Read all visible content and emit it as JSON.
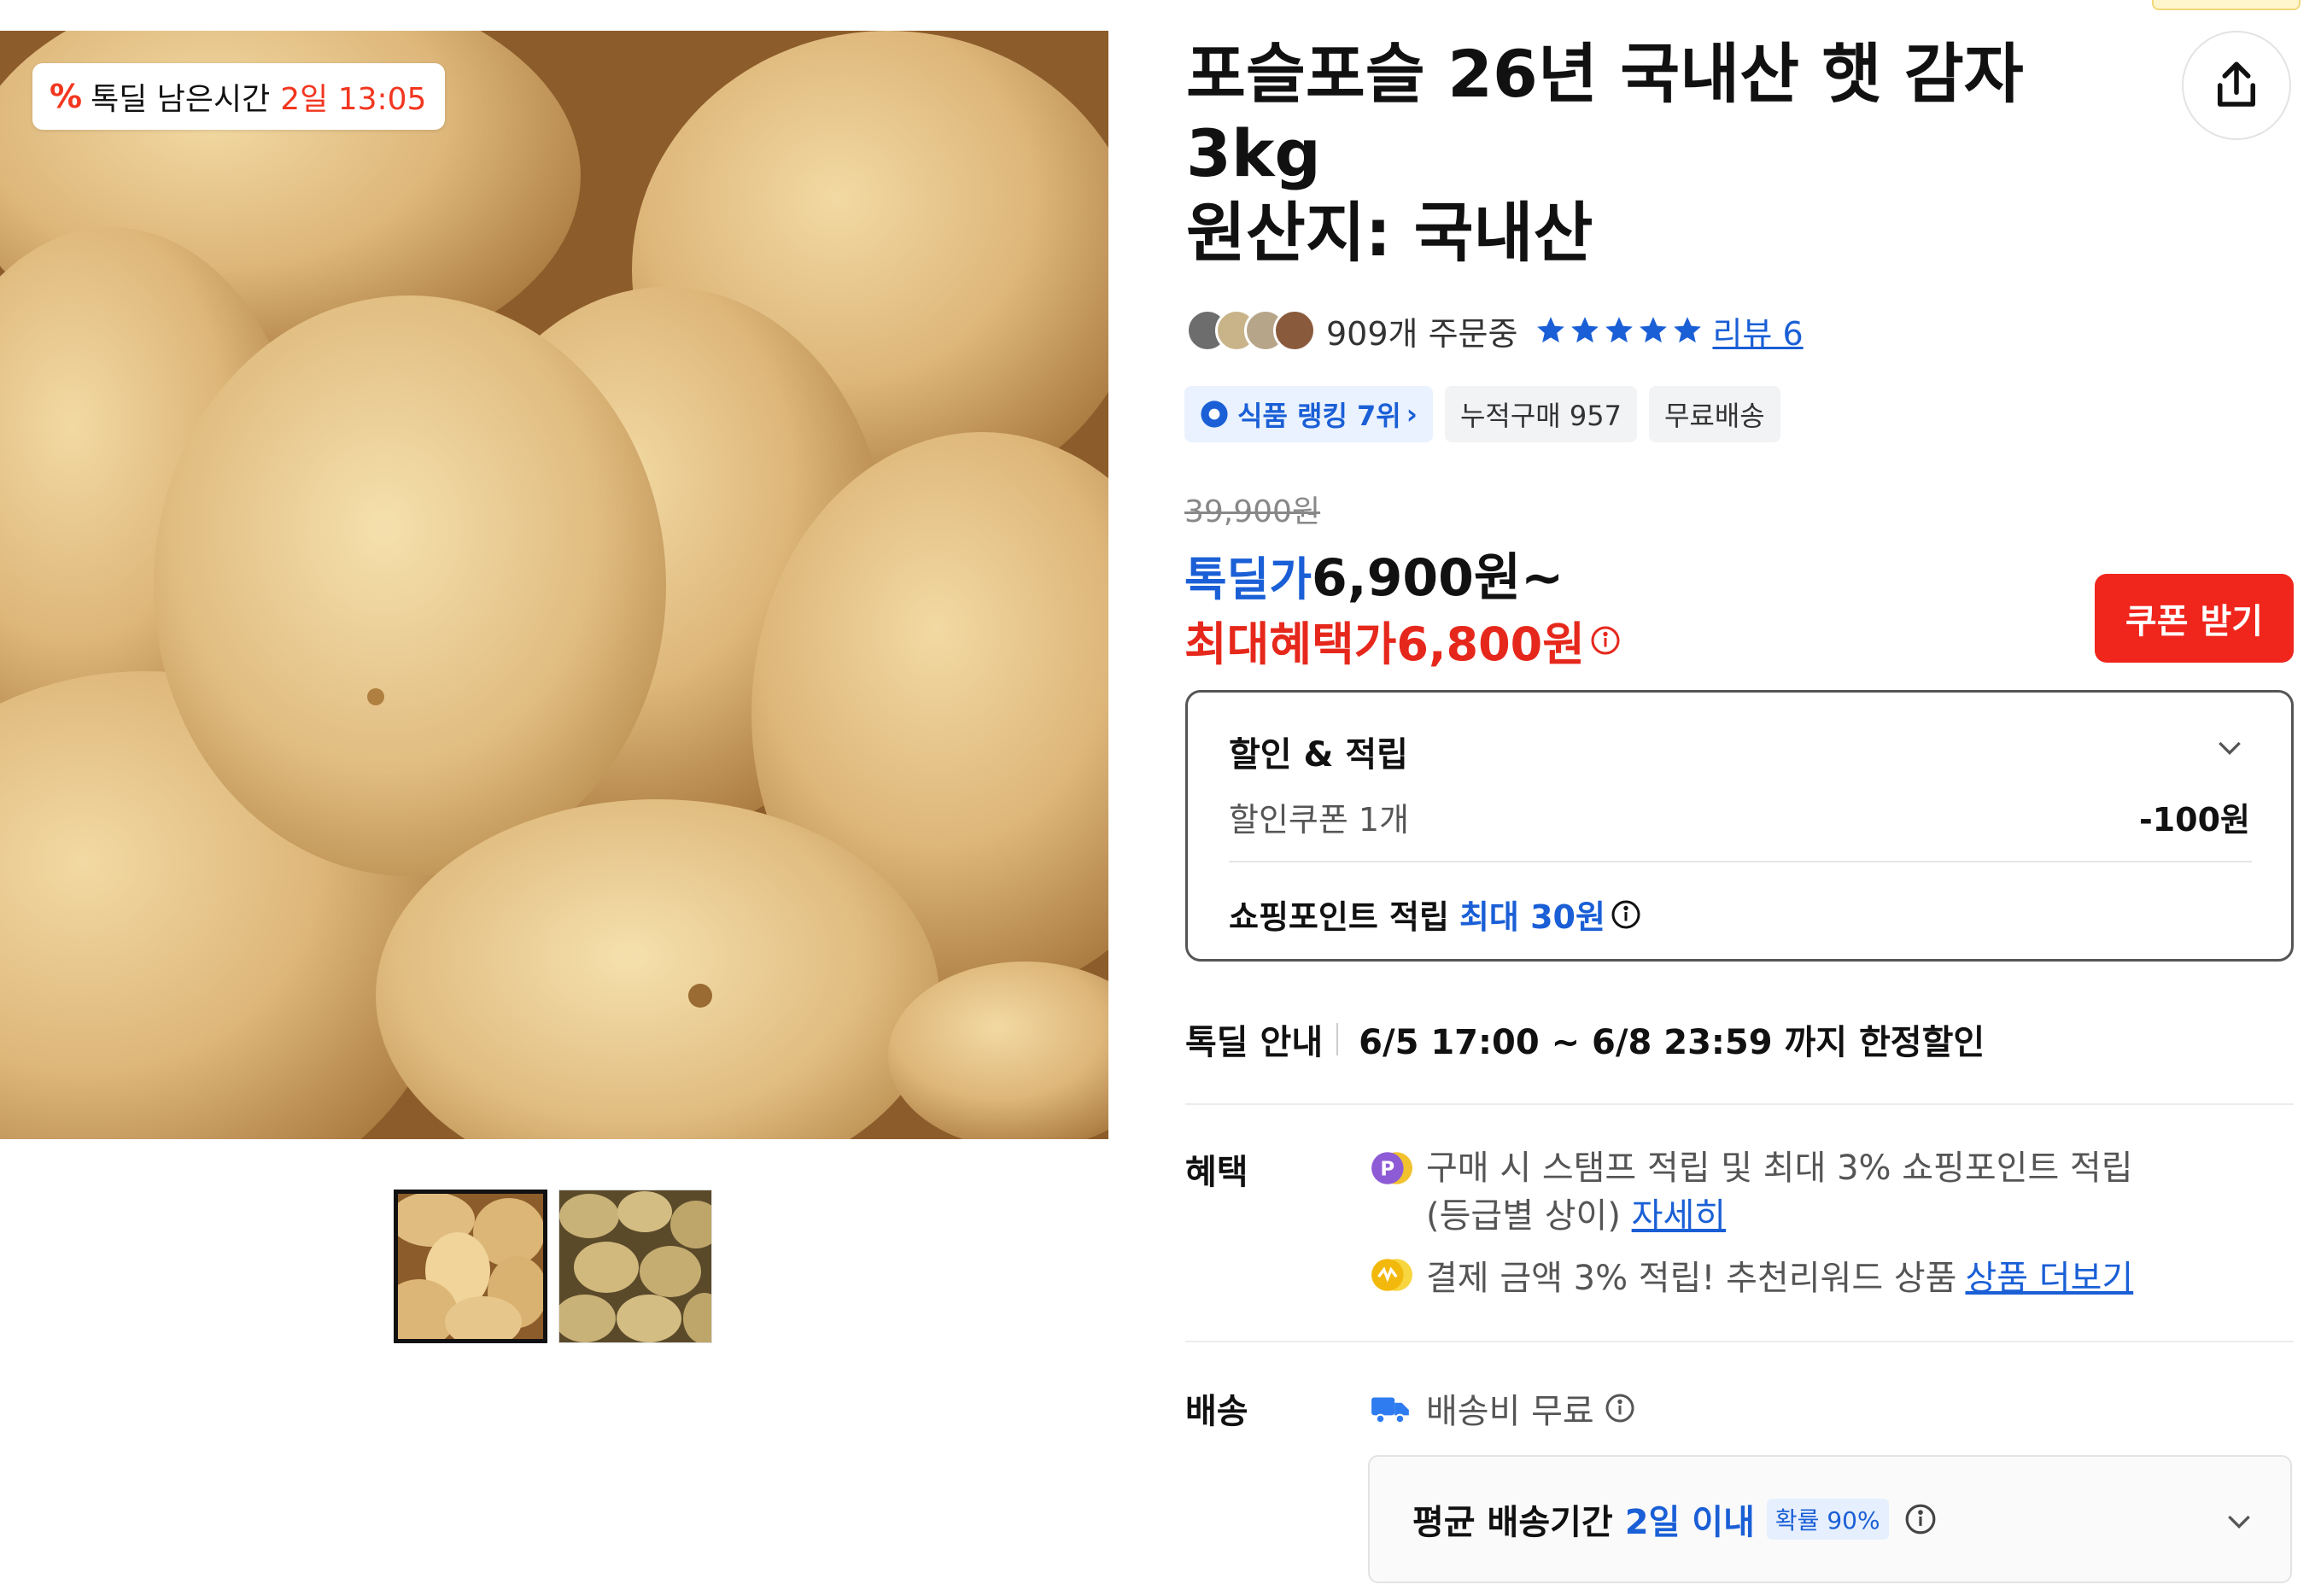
{
  "timer_badge": {
    "label": "톡딜 남은시간",
    "remaining": "2일 13:05"
  },
  "product": {
    "title_lines": [
      "포슬포슬 26년 국내산 햇 감자",
      "3kg",
      "원산지: 국내산"
    ]
  },
  "social": {
    "order_count": "909개 주문중",
    "rating_stars": 5,
    "review_link": "리뷰 6"
  },
  "chips": [
    {
      "label": "식품 랭킹 7위",
      "type": "rank"
    },
    {
      "label": "누적구매 957",
      "type": "plain"
    },
    {
      "label": "무료배송",
      "type": "plain"
    }
  ],
  "pricing": {
    "original_price": "39,900원",
    "deal_label": "톡딜가",
    "deal_price": "6,900원~",
    "max_benefit_label": "최대혜택가",
    "max_benefit_price": "6,800원"
  },
  "coupon_button": "쿠폰 받기",
  "discount_box": {
    "title": "할인 & 적립",
    "coupon_label": "할인쿠폰 1개",
    "coupon_value": "-100원",
    "points_label": "쇼핑포인트 적립",
    "points_value": "최대 30원"
  },
  "tokdeal_info": {
    "label": "톡딜 안내",
    "period": "6/5 17:00 ~ 6/8 23:59 까지 한정할인"
  },
  "benefits": {
    "label": "혜택",
    "item1_text_line1": "구매 시 스탬프 적립 및 최대 3% 쇼핑포인트 적립",
    "item1_text_line2": "(등급별 상이) ",
    "item1_link": "자세히",
    "item2_text": "결제 금액 3% 적립! 추천리워드 상품 ",
    "item2_link": "상품 더보기"
  },
  "shipping": {
    "label": "배송",
    "fee_text": "배송비 무료",
    "delivery_label": "평균 배송기간",
    "delivery_days": "2일 이내",
    "probability": "확률 90%"
  },
  "colors": {
    "accent_blue": "#1a5fd6",
    "accent_red": "#f0251c",
    "price_red": "#e6281c",
    "star_blue": "#1a5fd6"
  },
  "icons": {
    "share": "share-icon",
    "info": "info-icon",
    "chevron": "chevron-down-icon",
    "truck": "truck-icon",
    "points": "point-icon",
    "reward": "reward-icon"
  }
}
